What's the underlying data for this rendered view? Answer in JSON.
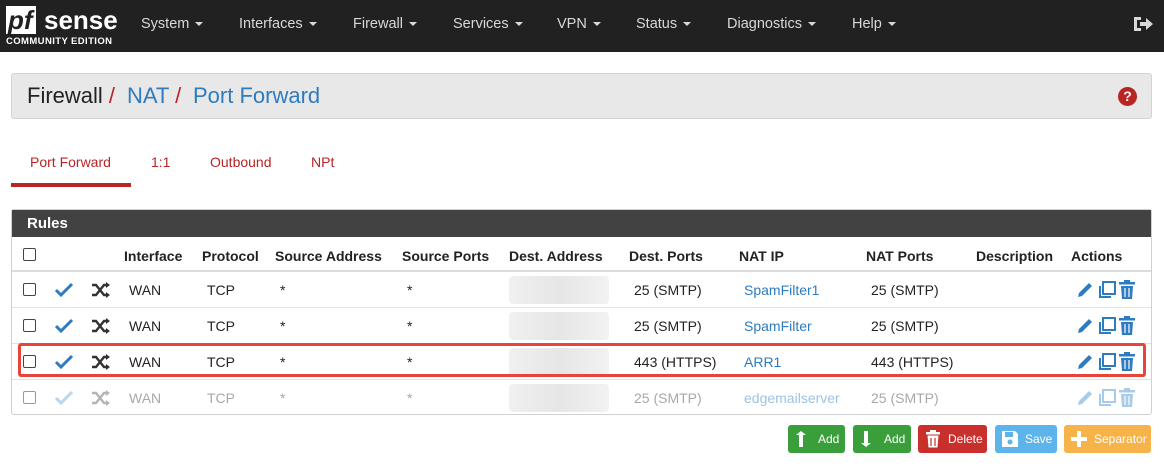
{
  "brand": {
    "logo_pf": "pf",
    "logo_sense": "sense",
    "edition": "COMMUNITY EDITION"
  },
  "nav": {
    "items": [
      "System",
      "Interfaces",
      "Firewall",
      "Services",
      "VPN",
      "Status",
      "Diagnostics",
      "Help"
    ],
    "logout_icon": "sign-out-icon"
  },
  "breadcrumb": {
    "part1": "Firewall",
    "part2": "NAT",
    "part3": "Port Forward",
    "separator": "/",
    "help_icon": "question-circle-icon"
  },
  "tabs": [
    {
      "label": "Port Forward",
      "active": true
    },
    {
      "label": "1:1",
      "active": false
    },
    {
      "label": "Outbound",
      "active": false
    },
    {
      "label": "NPt",
      "active": false
    }
  ],
  "panel": {
    "title": "Rules",
    "columns": [
      "Interface",
      "Protocol",
      "Source Address",
      "Source Ports",
      "Dest. Address",
      "Dest. Ports",
      "NAT IP",
      "NAT Ports",
      "Description",
      "Actions"
    ],
    "rows": [
      {
        "interface": "WAN",
        "protocol": "TCP",
        "source_address": "*",
        "source_ports": "*",
        "dest_ports": "25 (SMTP)",
        "nat_ip": "SpamFilter1",
        "nat_ports": "25 (SMTP)",
        "enabled": true
      },
      {
        "interface": "WAN",
        "protocol": "TCP",
        "source_address": "*",
        "source_ports": "*",
        "dest_ports": "25 (SMTP)",
        "nat_ip": "SpamFilter",
        "nat_ports": "25 (SMTP)",
        "enabled": true
      },
      {
        "interface": "WAN",
        "protocol": "TCP",
        "source_address": "*",
        "source_ports": "*",
        "dest_ports": "443 (HTTPS)",
        "nat_ip": "ARR1",
        "nat_ports": "443 (HTTPS)",
        "enabled": true,
        "highlighted": true
      },
      {
        "interface": "WAN",
        "protocol": "TCP",
        "source_address": "*",
        "source_ports": "*",
        "dest_ports": "25 (SMTP)",
        "nat_ip": "edgemailserver",
        "nat_ports": "25 (SMTP)",
        "enabled": false
      }
    ],
    "row_icons": [
      "check-icon",
      "random-shuffle-icon",
      "pencil-icon",
      "copy-icon",
      "trash-icon"
    ]
  },
  "buttons": {
    "add_top": "Add",
    "add_bottom": "Add",
    "delete": "Delete",
    "save": "Save",
    "separator": "Separator"
  },
  "colors": {
    "navbar": "#212121",
    "accent_red": "#b92525",
    "link_blue": "#2f7bbf",
    "green": "#3a9e3a",
    "red_button": "#c9302c",
    "blue_button": "#5cb4ea",
    "orange_button": "#f5b34a",
    "highlight_box": "#e8443c"
  }
}
